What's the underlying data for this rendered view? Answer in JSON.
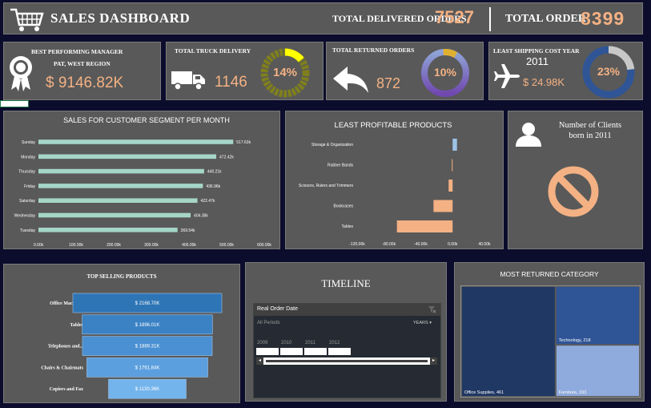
{
  "header": {
    "title": "SALES DASHBOARD",
    "delivered_label": "TOTAL DELIVERED ORDERS",
    "delivered_value": "7527",
    "total_label": "TOTAL ORDER",
    "total_value": "8399"
  },
  "kpis": {
    "manager": {
      "label": "BEST PERFORMING MANAGER",
      "name": "PAT, WEST REGION",
      "value": "$ 9146.82K"
    },
    "truck": {
      "label": "TOTAL TRUCK DELIVERY",
      "value": "1146",
      "percent_text": "14%",
      "percent": 14
    },
    "returned": {
      "label": "TOTAL RETURNED ORDERS",
      "value": "872",
      "percent_text": "10%",
      "percent": 10
    },
    "shipping": {
      "label": "LEAST SHIPPING COST YEAR",
      "year": "2011",
      "value": "$ 24.98K",
      "percent_text": "23%",
      "percent": 23
    }
  },
  "clients": {
    "title_line1": "Number of Clients",
    "title_line2": "born in 2011"
  },
  "timeline": {
    "title": "TIMELINE",
    "field": "Real Order Date",
    "periods": "All Periods",
    "unit": "YEARS",
    "years": [
      "2009",
      "2010",
      "2011",
      "2012"
    ]
  },
  "colors": {
    "accent": "#f4b183",
    "panel": "#595959",
    "background": "#0c0c2c"
  },
  "chart_data": [
    {
      "type": "bar",
      "title": "SALES FOR CUSTOMER SEGMENT PER MONTH",
      "orientation": "horizontal",
      "categories": [
        "Sunday",
        "Monday",
        "Thursday",
        "Friday",
        "Saturday",
        "Wednesday",
        "Tuesday"
      ],
      "values": [
        517.63,
        472.42,
        440.21,
        436.96,
        422.47,
        404.38,
        369.54
      ],
      "data_labels": [
        "517.63k",
        "472.42k",
        "440.21k",
        "436.96k",
        "422.47k",
        "404.38k",
        "369.54k"
      ],
      "ticks": [
        "0.00k",
        "100.00k",
        "200.00k",
        "300.00k",
        "400.00k",
        "500.00k",
        "600.00k"
      ],
      "xlim": [
        0,
        600
      ],
      "color": "#a5d6c8"
    },
    {
      "type": "bar",
      "title": "LEAST PROFITABLE PRODUCTS",
      "orientation": "horizontal",
      "categories": [
        "Storage & Organization",
        "Rubber Bands",
        "Scissors, Rulers and Trimmers",
        "Bookcases",
        "Tables"
      ],
      "values": [
        5.5,
        -1.0,
        -5.0,
        -24.0,
        -70.0
      ],
      "ticks": [
        "-120.00k",
        "-80.00k",
        "-40.00k",
        "0.00k",
        "40.00k"
      ],
      "xlim": [
        -120,
        40
      ],
      "colors": {
        "positive": "#9dc3e6",
        "negative": "#f4b183"
      }
    },
    {
      "type": "bar",
      "title": "TOP SELLING PRODUCTS",
      "subtype": "funnel",
      "categories": [
        "Office Machines",
        "Tables",
        "Telephones and...",
        "Chairs & Chairmats",
        "Copiers and Fax"
      ],
      "values": [
        2168.7,
        1896.01,
        1889.31,
        1761.84,
        1130.36
      ],
      "data_labels": [
        "$ 2168.70K",
        "$ 1896.01K",
        "$ 1889.31K",
        "$ 1761.84K",
        "$ 1130.36K"
      ],
      "colors": [
        "#2e75b6",
        "#3a82c4",
        "#4a90d2",
        "#5c9fde",
        "#74b4ec"
      ]
    },
    {
      "type": "heatmap",
      "subtype": "treemap",
      "title": "MOST RETURNED CATEGORY",
      "categories": [
        "Office Supplies",
        "Technology",
        "Furniture"
      ],
      "values": [
        461,
        218,
        193
      ],
      "data_labels": [
        "Office Supplies, 461",
        "Technology, 218",
        "Furniture, 193"
      ],
      "colors": [
        "#203864",
        "#2f5597",
        "#8faadc"
      ]
    }
  ]
}
